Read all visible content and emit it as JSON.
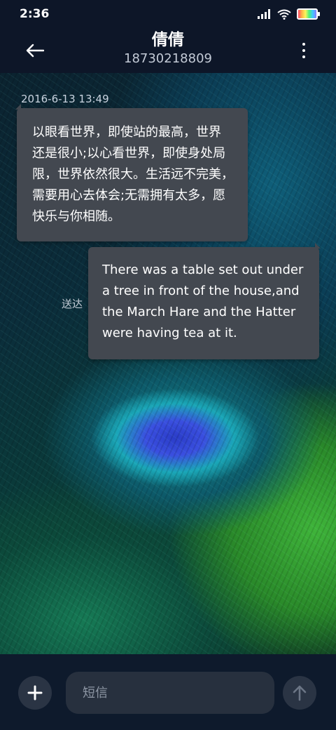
{
  "status_bar": {
    "time": "2:36",
    "icons": [
      "signal-icon",
      "wifi-icon",
      "battery-icon"
    ]
  },
  "header": {
    "contact_name": "倩倩",
    "contact_number": "18730218809",
    "icons": [
      "back-arrow-icon",
      "more-vertical-icon"
    ]
  },
  "conversation": {
    "timestamp": "2016-6-13 13:49",
    "messages": [
      {
        "direction": "incoming",
        "lines": [
          "以眼看世界，即使站的最高，世界",
          "还是很小;以心看世界，即使身处局",
          "限，世界依然很大。生活远不完美，",
          "需要用心去体会;无需拥有太多，愿",
          "快乐与你相随。"
        ]
      },
      {
        "direction": "outgoing",
        "lines": [
          "There was a table set out under",
          "a tree in front of the house,and",
          "the March Hare and the Hatter",
          "were having tea at it."
        ],
        "status": "送达"
      }
    ]
  },
  "composer": {
    "placeholder": "短信",
    "icons": [
      "plus-icon",
      "send-arrow-icon"
    ]
  },
  "colors": {
    "bar_background": "#0d1628",
    "bubble": "#434850",
    "input_background": "#27303e"
  }
}
